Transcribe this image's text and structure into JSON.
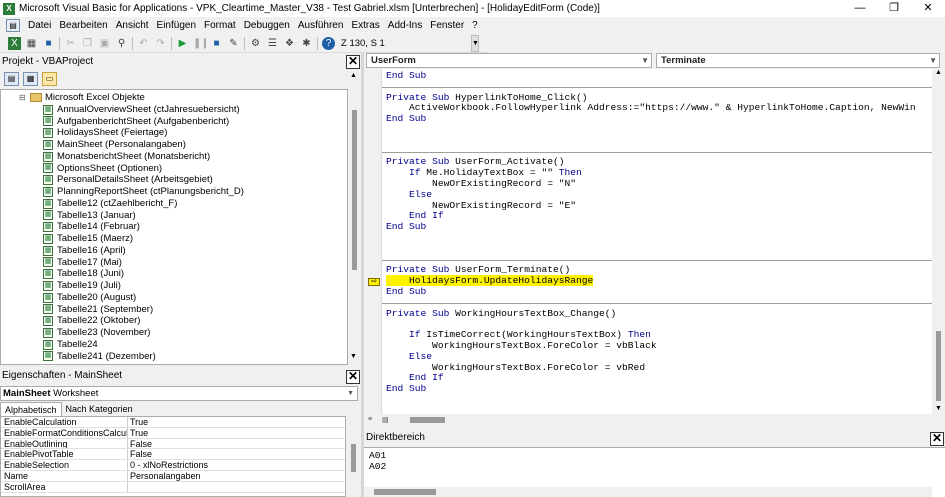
{
  "window": {
    "title": "Microsoft Visual Basic for Applications - VPK_Cleartime_Master_V38 - Test Gabriel.xlsm [Unterbrechen] - [HolidayEditForm (Code)]",
    "minimize": "—",
    "maximize": "❐",
    "close": "✕"
  },
  "menubar": {
    "items": [
      "Datei",
      "Bearbeiten",
      "Ansicht",
      "Einfügen",
      "Format",
      "Debuggen",
      "Ausführen",
      "Extras",
      "Add-Ins",
      "Fenster",
      "?"
    ]
  },
  "toolbar": {
    "cursor_position": "Z 130, S 1"
  },
  "project_pane": {
    "title": "Projekt - VBAProject",
    "close": "✕",
    "tree": [
      {
        "label": "Microsoft Excel Objekte",
        "level": 0,
        "type": "folder"
      },
      {
        "label": "AnnualOverviewSheet (ctJahresuebersicht)",
        "level": 1,
        "type": "sheet"
      },
      {
        "label": "AufgabenberichtSheet (Aufgabenbericht)",
        "level": 1,
        "type": "sheet"
      },
      {
        "label": "HolidaysSheet (Feiertage)",
        "level": 1,
        "type": "sheet"
      },
      {
        "label": "MainSheet (Personalangaben)",
        "level": 1,
        "type": "sheet"
      },
      {
        "label": "MonatsberichtSheet (Monatsbericht)",
        "level": 1,
        "type": "sheet"
      },
      {
        "label": "OptionsSheet (Optionen)",
        "level": 1,
        "type": "sheet"
      },
      {
        "label": "PersonalDetailsSheet (Arbeitsgebiet)",
        "level": 1,
        "type": "sheet"
      },
      {
        "label": "PlanningReportSheet (ctPlanungsbericht_D)",
        "level": 1,
        "type": "sheet"
      },
      {
        "label": "Tabelle12 (ctZaehlbericht_F)",
        "level": 1,
        "type": "sheet"
      },
      {
        "label": "Tabelle13 (Januar)",
        "level": 1,
        "type": "sheet"
      },
      {
        "label": "Tabelle14 (Februar)",
        "level": 1,
        "type": "sheet"
      },
      {
        "label": "Tabelle15 (Maerz)",
        "level": 1,
        "type": "sheet"
      },
      {
        "label": "Tabelle16 (April)",
        "level": 1,
        "type": "sheet"
      },
      {
        "label": "Tabelle17 (Mai)",
        "level": 1,
        "type": "sheet"
      },
      {
        "label": "Tabelle18 (Juni)",
        "level": 1,
        "type": "sheet"
      },
      {
        "label": "Tabelle19 (Juli)",
        "level": 1,
        "type": "sheet"
      },
      {
        "label": "Tabelle20 (August)",
        "level": 1,
        "type": "sheet"
      },
      {
        "label": "Tabelle21 (September)",
        "level": 1,
        "type": "sheet"
      },
      {
        "label": "Tabelle22 (Oktober)",
        "level": 1,
        "type": "sheet"
      },
      {
        "label": "Tabelle23 (November)",
        "level": 1,
        "type": "sheet"
      },
      {
        "label": "Tabelle24",
        "level": 1,
        "type": "sheet"
      },
      {
        "label": "Tabelle241 (Dezember)",
        "level": 1,
        "type": "sheet"
      }
    ]
  },
  "properties_pane": {
    "title": "Eigenschaften - MainSheet",
    "close": "✕",
    "object_name": "MainSheet",
    "object_type": "Worksheet",
    "tabs": [
      "Alphabetisch",
      "Nach Kategorien"
    ],
    "rows": [
      {
        "name": "EnableCalculation",
        "value": "True"
      },
      {
        "name": "EnableFormatConditionsCalculation",
        "value": "True"
      },
      {
        "name": "EnableOutlining",
        "value": "False"
      },
      {
        "name": "EnablePivotTable",
        "value": "False"
      },
      {
        "name": "EnableSelection",
        "value": "0 - xlNoRestrictions"
      },
      {
        "name": "Name",
        "value": "Personalangaben"
      },
      {
        "name": "ScrollArea",
        "value": ""
      }
    ]
  },
  "code_window": {
    "object_combo": "UserForm",
    "procedure_combo": "Terminate",
    "lines": [
      {
        "text": "End Sub",
        "kw": true
      },
      {
        "text": "",
        "sep": true
      },
      {
        "text": "Private Sub HyperlinkToHome_Click()",
        "kw": true
      },
      {
        "text": "    ActiveWorkbook.FollowHyperlink Address:=\"https://www.\" & HyperlinkToHome.Caption, NewWin"
      },
      {
        "text": "End Sub",
        "kw": true
      },
      {
        "text": ""
      },
      {
        "text": ""
      },
      {
        "text": "",
        "sep": true
      },
      {
        "text": "Private Sub UserForm_Activate()",
        "kw": true
      },
      {
        "text": "    If Me.HolidayTextBox = \"\" Then",
        "kw": true
      },
      {
        "text": "        NewOrExistingRecord = \"N\""
      },
      {
        "text": "    Else",
        "kw": true
      },
      {
        "text": "        NewOrExistingRecord = \"E\""
      },
      {
        "text": "    End If",
        "kw": true
      },
      {
        "text": "End Sub",
        "kw": true
      },
      {
        "text": ""
      },
      {
        "text": ""
      },
      {
        "text": "",
        "sep": true
      },
      {
        "text": "Private Sub UserForm_Terminate()",
        "kw": true
      },
      {
        "text": "    HolidaysForm.UpdateHolidaysRange",
        "hl": true
      },
      {
        "text": "End Sub",
        "kw": true
      },
      {
        "text": "",
        "sep": true
      },
      {
        "text": "Private Sub WorkingHoursTextBox_Change()",
        "kw": true
      },
      {
        "text": ""
      },
      {
        "text": "    If IsTimeCorrect(WorkingHoursTextBox) Then",
        "kw": true
      },
      {
        "text": "        WorkingHoursTextBox.ForeColor = vbBlack"
      },
      {
        "text": "    Else",
        "kw": true
      },
      {
        "text": "        WorkingHoursTextBox.ForeColor = vbRed"
      },
      {
        "text": "    End If",
        "kw": true
      },
      {
        "text": "End Sub",
        "kw": true
      }
    ]
  },
  "immediate_pane": {
    "title": "Direktbereich",
    "close": "✕",
    "lines": [
      "A01",
      "A02"
    ]
  }
}
